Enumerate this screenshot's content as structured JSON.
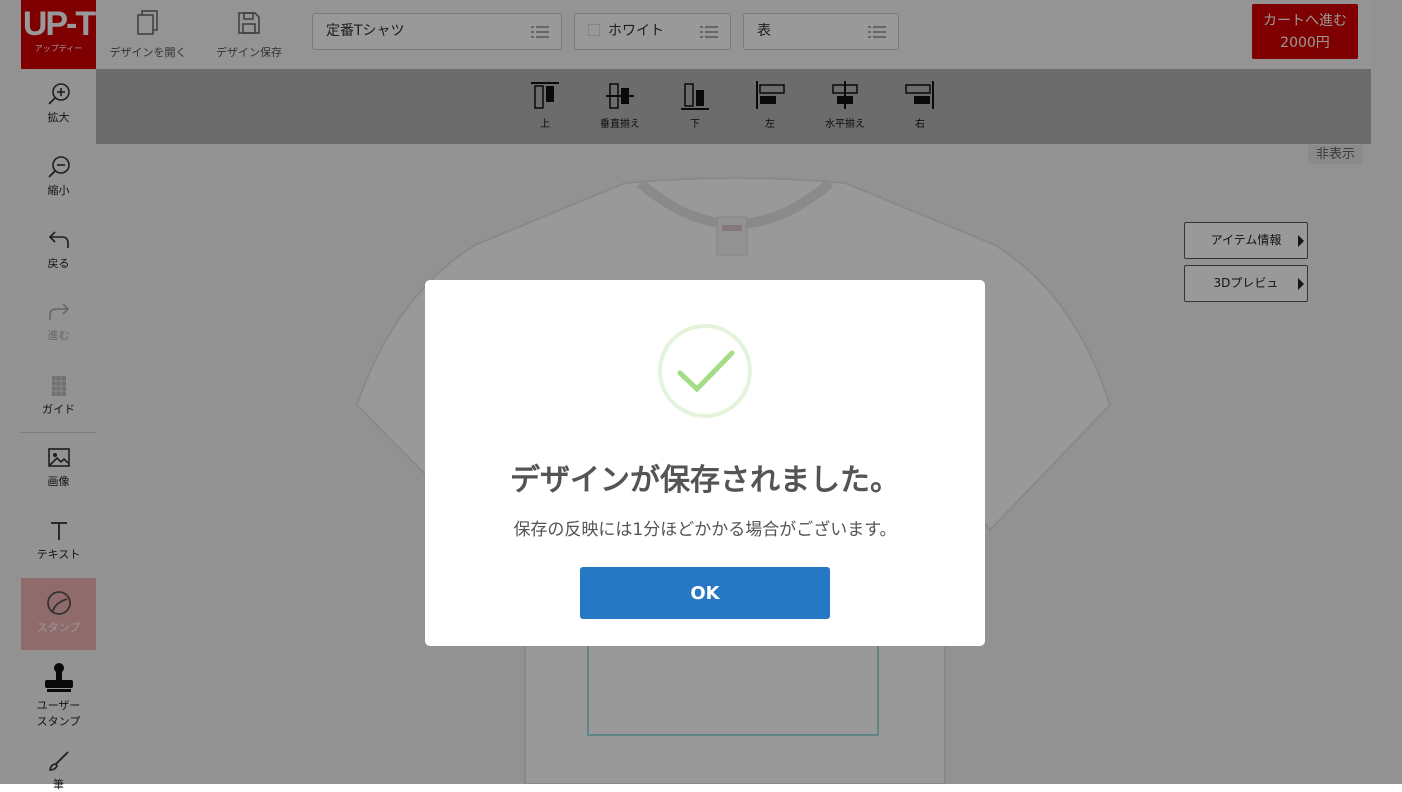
{
  "logo": {
    "main": "UP-T",
    "sub": "アップティー"
  },
  "topbar": {
    "open_design": "デザインを開く",
    "save_design": "デザイン保存",
    "product_select": "定番Tシャツ",
    "color_select": "ホワイト",
    "side_select": "表",
    "cart_line1": "カートへ進む",
    "cart_line2": "2000円"
  },
  "alignbar": {
    "items": [
      "上",
      "垂直揃え",
      "下",
      "左",
      "水平揃え",
      "右"
    ]
  },
  "sidebar": {
    "zoom_in": "拡大",
    "zoom_out": "縮小",
    "undo": "戻る",
    "redo": "進む",
    "guide": "ガイド",
    "image": "画像",
    "text": "テキスト",
    "stamp": "スタンプ",
    "user_stamp_1": "ユーザー",
    "user_stamp_2": "スタンプ",
    "brush": "筆"
  },
  "canvas": {
    "hide_label": "非表示",
    "item_info": "アイテム情報",
    "preview_3d": "3Dプレビュ"
  },
  "modal": {
    "title": "デザインが保存されました。",
    "message": "保存の反映には1分ほどかかる場合がございます。",
    "ok": "OK"
  },
  "colors": {
    "brand": "#d40000",
    "ok_button": "#2778c4",
    "success": "#a5dc86"
  }
}
